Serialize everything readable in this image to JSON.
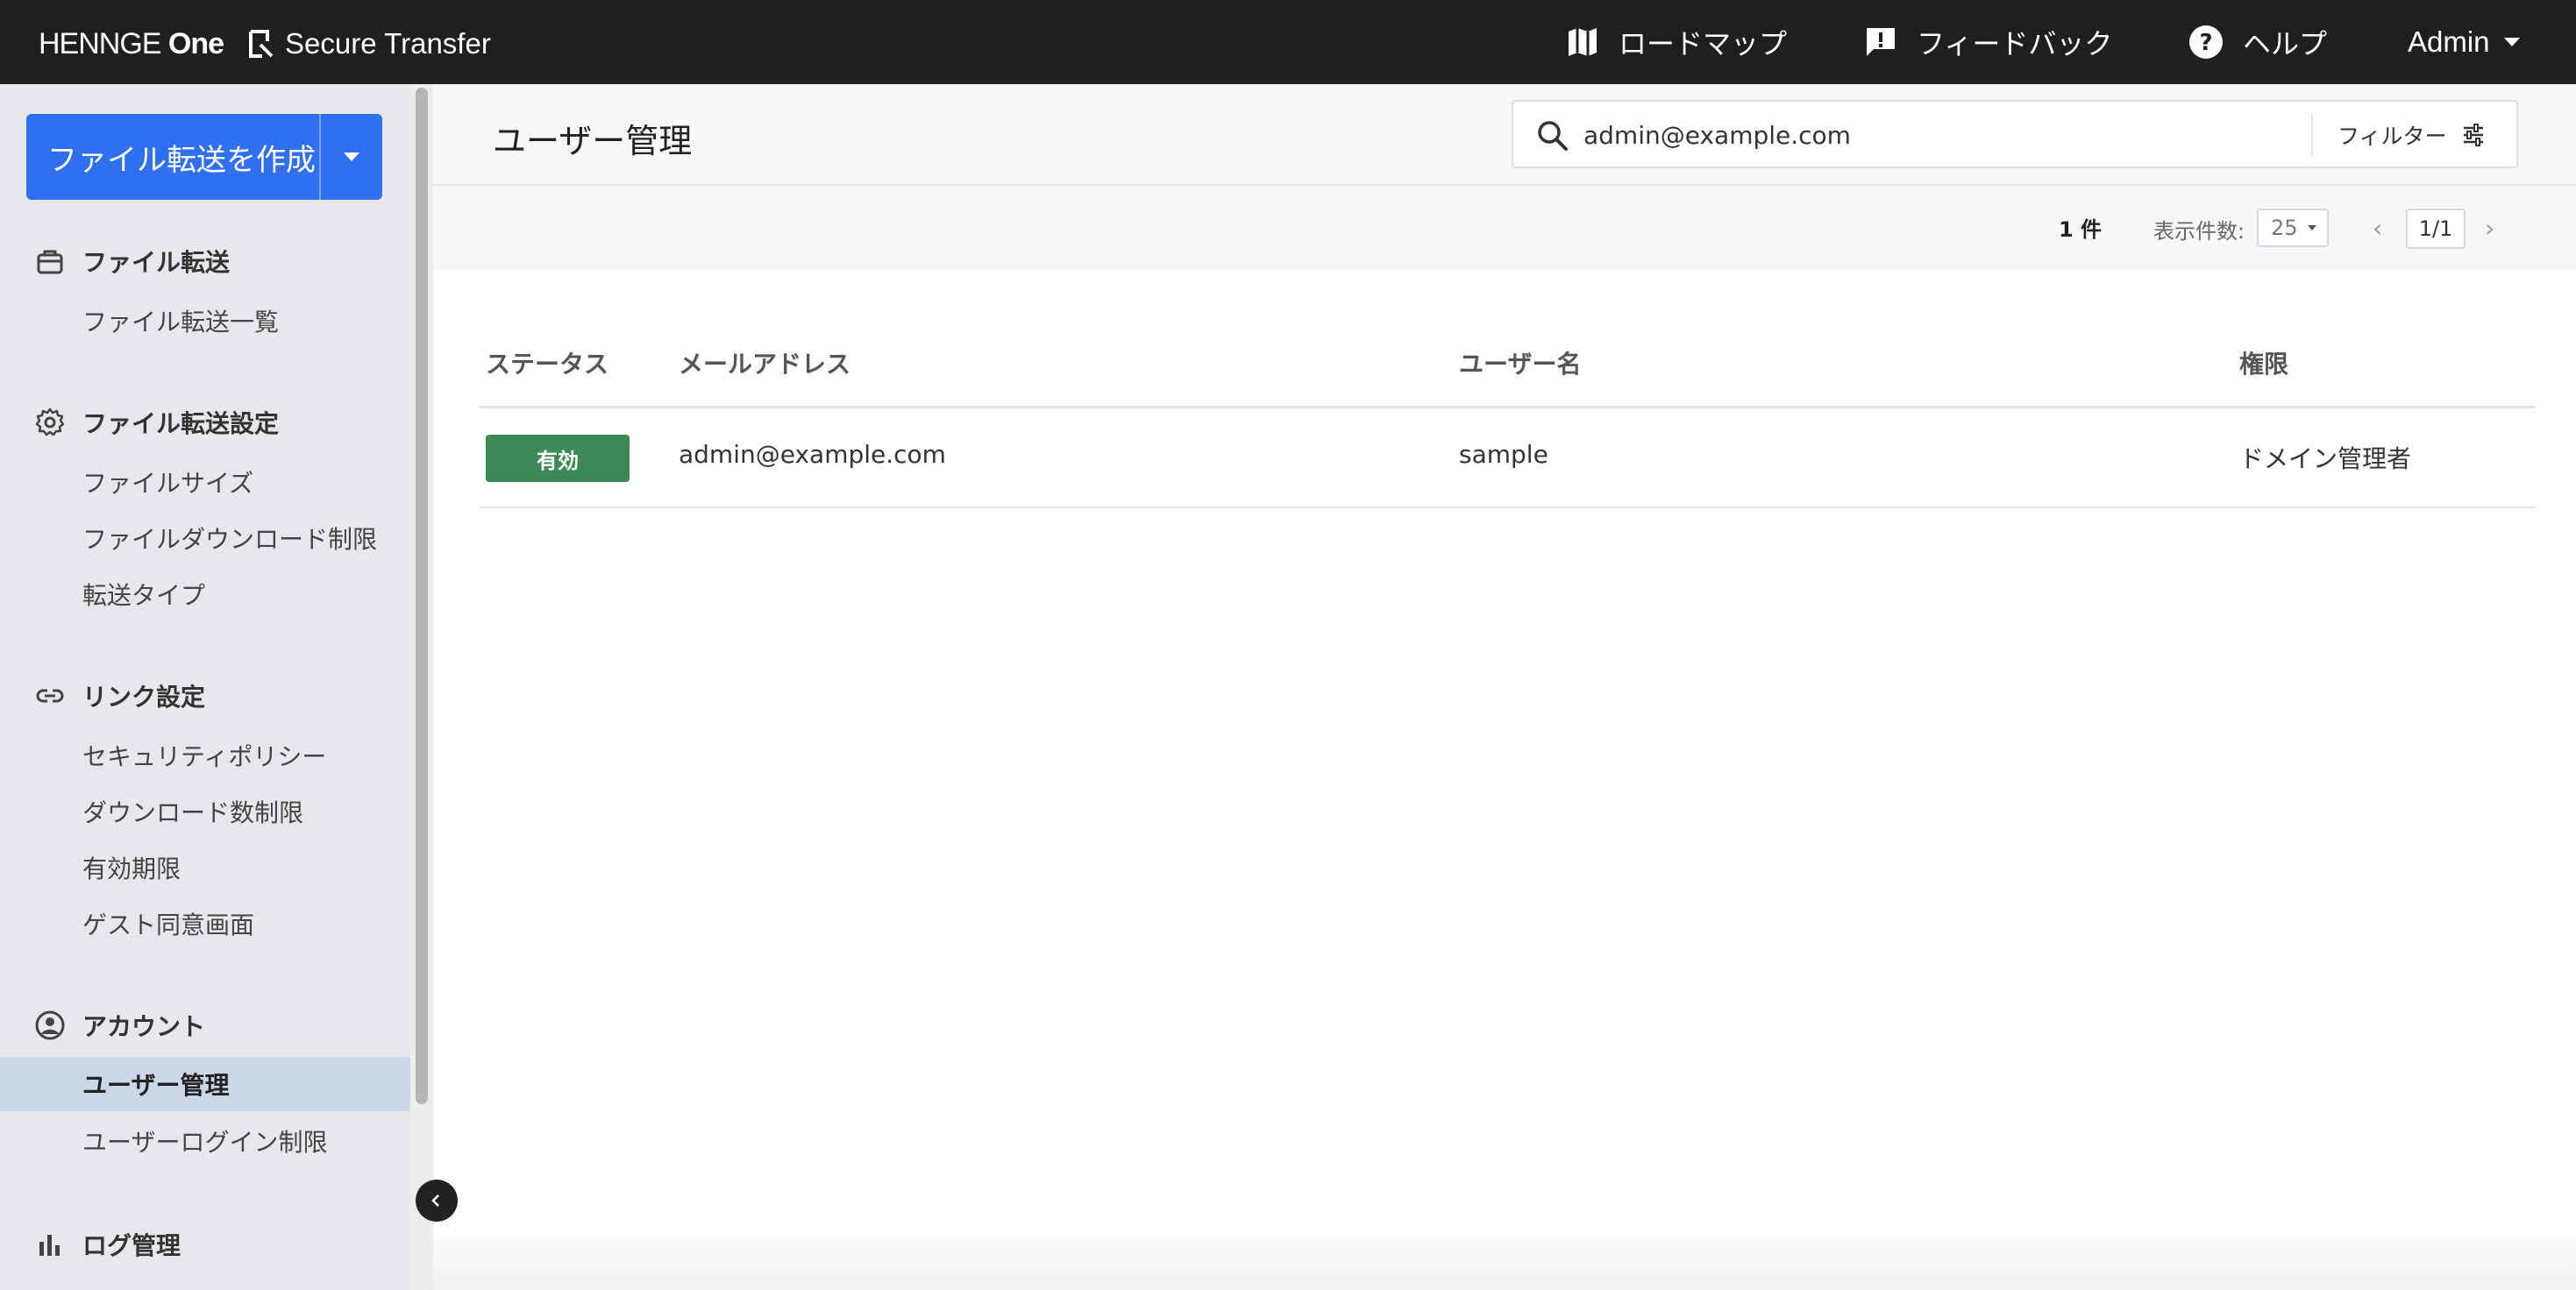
{
  "topbar": {
    "brand_logo": "HENNGE",
    "brand_logo_suffix": "One",
    "product": "Secure Transfer",
    "nav": {
      "roadmap": "ロードマップ",
      "feedback": "フィードバック",
      "help": "ヘルプ",
      "admin": "Admin"
    }
  },
  "sidebar": {
    "create_button": "ファイル転送を作成",
    "sections": {
      "transfer": {
        "title": "ファイル転送",
        "items": [
          "ファイル転送一覧"
        ]
      },
      "transfer_settings": {
        "title": "ファイル転送設定",
        "items": [
          "ファイルサイズ",
          "ファイルダウンロード制限",
          "転送タイプ"
        ]
      },
      "link_settings": {
        "title": "リンク設定",
        "items": [
          "セキュリティポリシー",
          "ダウンロード数制限",
          "有効期限",
          "ゲスト同意画面"
        ]
      },
      "account": {
        "title": "アカウント",
        "items": [
          "ユーザー管理",
          "ユーザーログイン制限"
        ]
      },
      "logs": {
        "title": "ログ管理"
      }
    },
    "active_item": "ユーザー管理"
  },
  "main": {
    "title": "ユーザー管理",
    "search": {
      "value": "admin@example.com"
    },
    "filter_label": "フィルター",
    "count": "1 件",
    "per_page_label": "表示件数:",
    "per_page_value": "25",
    "page_indicator": "1/1",
    "prev": "‹",
    "next": "›"
  },
  "table": {
    "headers": {
      "status": "ステータス",
      "email": "メールアドレス",
      "username": "ユーザー名",
      "role": "権限"
    },
    "rows": [
      {
        "status": "有効",
        "email": "admin@example.com",
        "username": "sample",
        "role": "ドメイン管理者"
      }
    ]
  },
  "colors": {
    "topbar": "#1f1f1f",
    "primary": "#2f6ff0",
    "status_active": "#3d8a56",
    "sidebar_bg": "#e6e8eb",
    "sidebar_active": "#cbd7e8"
  }
}
